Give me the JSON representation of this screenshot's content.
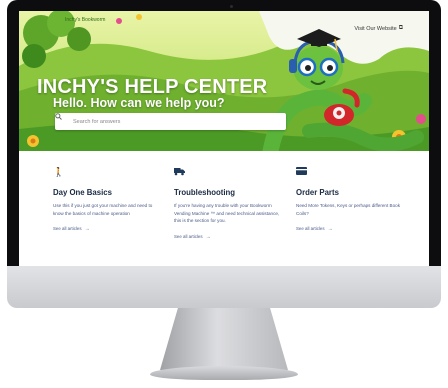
{
  "hero": {
    "brand": "Inchy's Bookworm",
    "visit_link": "Visit Our Website",
    "title": "INCHY'S HELP CENTER",
    "subtitle": "Hello. How can we help you?",
    "search_placeholder": "Search for answers"
  },
  "cards": [
    {
      "icon": "person-walking-icon",
      "title": "Day One Basics",
      "description": "Use this if you just got your machine and need to know the basics of machine operation",
      "link": "See all articles"
    },
    {
      "icon": "truck-icon",
      "title": "Troubleshooting",
      "description": "If you're having any trouble with your Bookworm Vending Machine ™ and need technical assistance, this is the section for you.",
      "link": "See all articles"
    },
    {
      "icon": "credit-card-icon",
      "title": "Order Parts",
      "description": "Need More Tokens, Keys or perhaps different Book Coils?",
      "link": "See all articles"
    }
  ],
  "colors": {
    "hero_green": "#9ccf3f",
    "title_color": "#1a2a44",
    "text_color": "#4a5a88"
  }
}
